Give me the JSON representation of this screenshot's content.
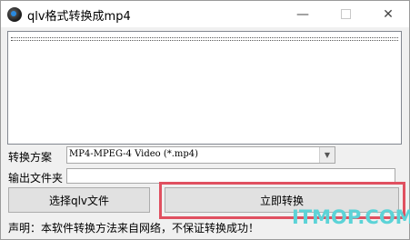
{
  "window": {
    "title": "qlv格式转换成mp4",
    "minimize_glyph": "—",
    "close_glyph": "✕",
    "icons": {
      "app": "app-icon",
      "minimize": "minimize-icon",
      "maximize": "maximize-icon",
      "close": "close-icon"
    }
  },
  "form": {
    "scheme_label": "转换方案",
    "scheme_value": "MP4-MPEG-4 Video (*.mp4)",
    "scheme_arrow_glyph": "▼",
    "folder_label": "输出文件夹",
    "folder_value": ""
  },
  "buttons": {
    "select_label": "选择qlv文件",
    "convert_label": "立即转换"
  },
  "statement": "声明：本软件转换方法来自网络，不保证转换成功！",
  "watermark": "ITMOP.COM",
  "colors": {
    "highlight": "#e05060",
    "watermark": "#5cd3d7"
  }
}
